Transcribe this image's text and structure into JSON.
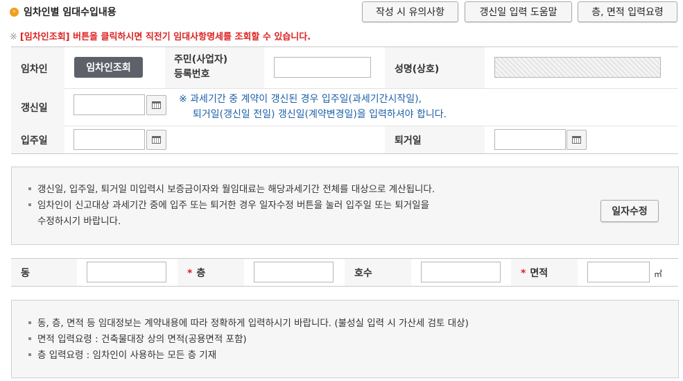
{
  "header": {
    "bullet_icon": "chevron-right-circle-icon",
    "title": "임차인별 임대수입내용",
    "buttons": [
      "작성 시 유의사항",
      "갱신일 입력 도움말",
      "층, 면적 입력요령"
    ]
  },
  "notice": {
    "mark": "※",
    "text": "[임차인조회] 버튼을 클릭하시면 직전기 임대사항명세를 조회할 수 있습니다."
  },
  "form": {
    "tenant_label": "임차인",
    "tenant_lookup_button": "임차인조회",
    "reg_no_label_line1": "주민(사업자)",
    "reg_no_label_line2": "등록번호",
    "reg_no_value": "",
    "name_label": "성명(상호)",
    "name_value": "",
    "renewal_label": "갱신일",
    "renewal_value": "",
    "renewal_note_line1": "※ 과세기간 중 계약이 갱신된 경우 입주일(과세기간시작일),",
    "renewal_note_line2": "퇴거일(갱신일 전일) 갱신일(계약변경일)을 입력하셔야 합니다.",
    "move_in_label": "입주일",
    "move_in_value": "",
    "move_out_label": "퇴거일",
    "move_out_value": "",
    "calendar_icon": "calendar-icon"
  },
  "info_box_1": {
    "line1": "갱신일, 입주일, 퇴거일 미입력시 보증금이자와 월임대료는 해당과세기간 전체를 대상으로 계산됩니다.",
    "line2": "임차인이 신고대상 과세기간 중에 입주 또는 퇴거한 경우 일자수정 버튼을 눌러 입주일 또는 퇴거일을",
    "line3": "수정하시기 바랍니다.",
    "date_edit_button": "일자수정"
  },
  "unit_row": {
    "dong_label": "동",
    "floor_label": "층",
    "ho_label": "호수",
    "area_label": "면적",
    "required_mark": "*",
    "area_unit": "㎡",
    "dong_value": "",
    "floor_value": "",
    "ho_value": "",
    "area_value": ""
  },
  "info_box_2": {
    "line1": "동, 층, 면적 등 임대정보는 계약내용에 따라 정확하게 입력하시기 바랍니다. (불성실 입력 시 가산세 검토 대상)",
    "line2": "면적 입력요령 : 건축물대장 상의 면적(공용면적 포함)",
    "line3": "층 입력요령 : 임차인이 사용하는 모든 층 기재"
  }
}
